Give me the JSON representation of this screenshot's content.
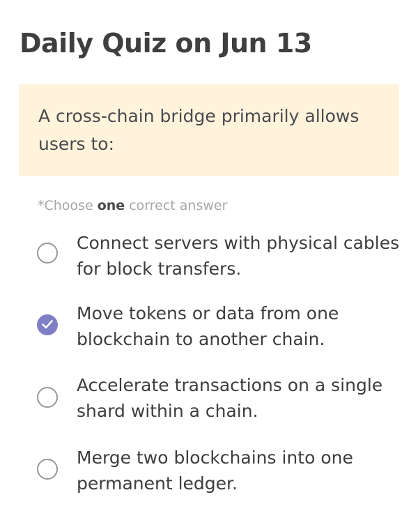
{
  "title": "Daily Quiz on Jun 13",
  "question": "A cross-chain bridge primarily allows users to:",
  "instruction": {
    "prefix": "*Choose ",
    "emphasis": "one",
    "suffix": " correct answer"
  },
  "options": [
    {
      "text": "Connect servers with physical cables for block transfers.",
      "selected": false
    },
    {
      "text": "Move tokens or data from one blockchain to another chain.",
      "selected": true
    },
    {
      "text": "Accelerate transactions on a single shard within a chain.",
      "selected": false
    },
    {
      "text": "Merge two blockchains into one permanent ledger.",
      "selected": false
    }
  ],
  "colors": {
    "question_background": "#fff3dc",
    "selected_radio": "#7f7fc6",
    "title_text": "#3f3f42",
    "muted_text": "#a6a6aa"
  }
}
